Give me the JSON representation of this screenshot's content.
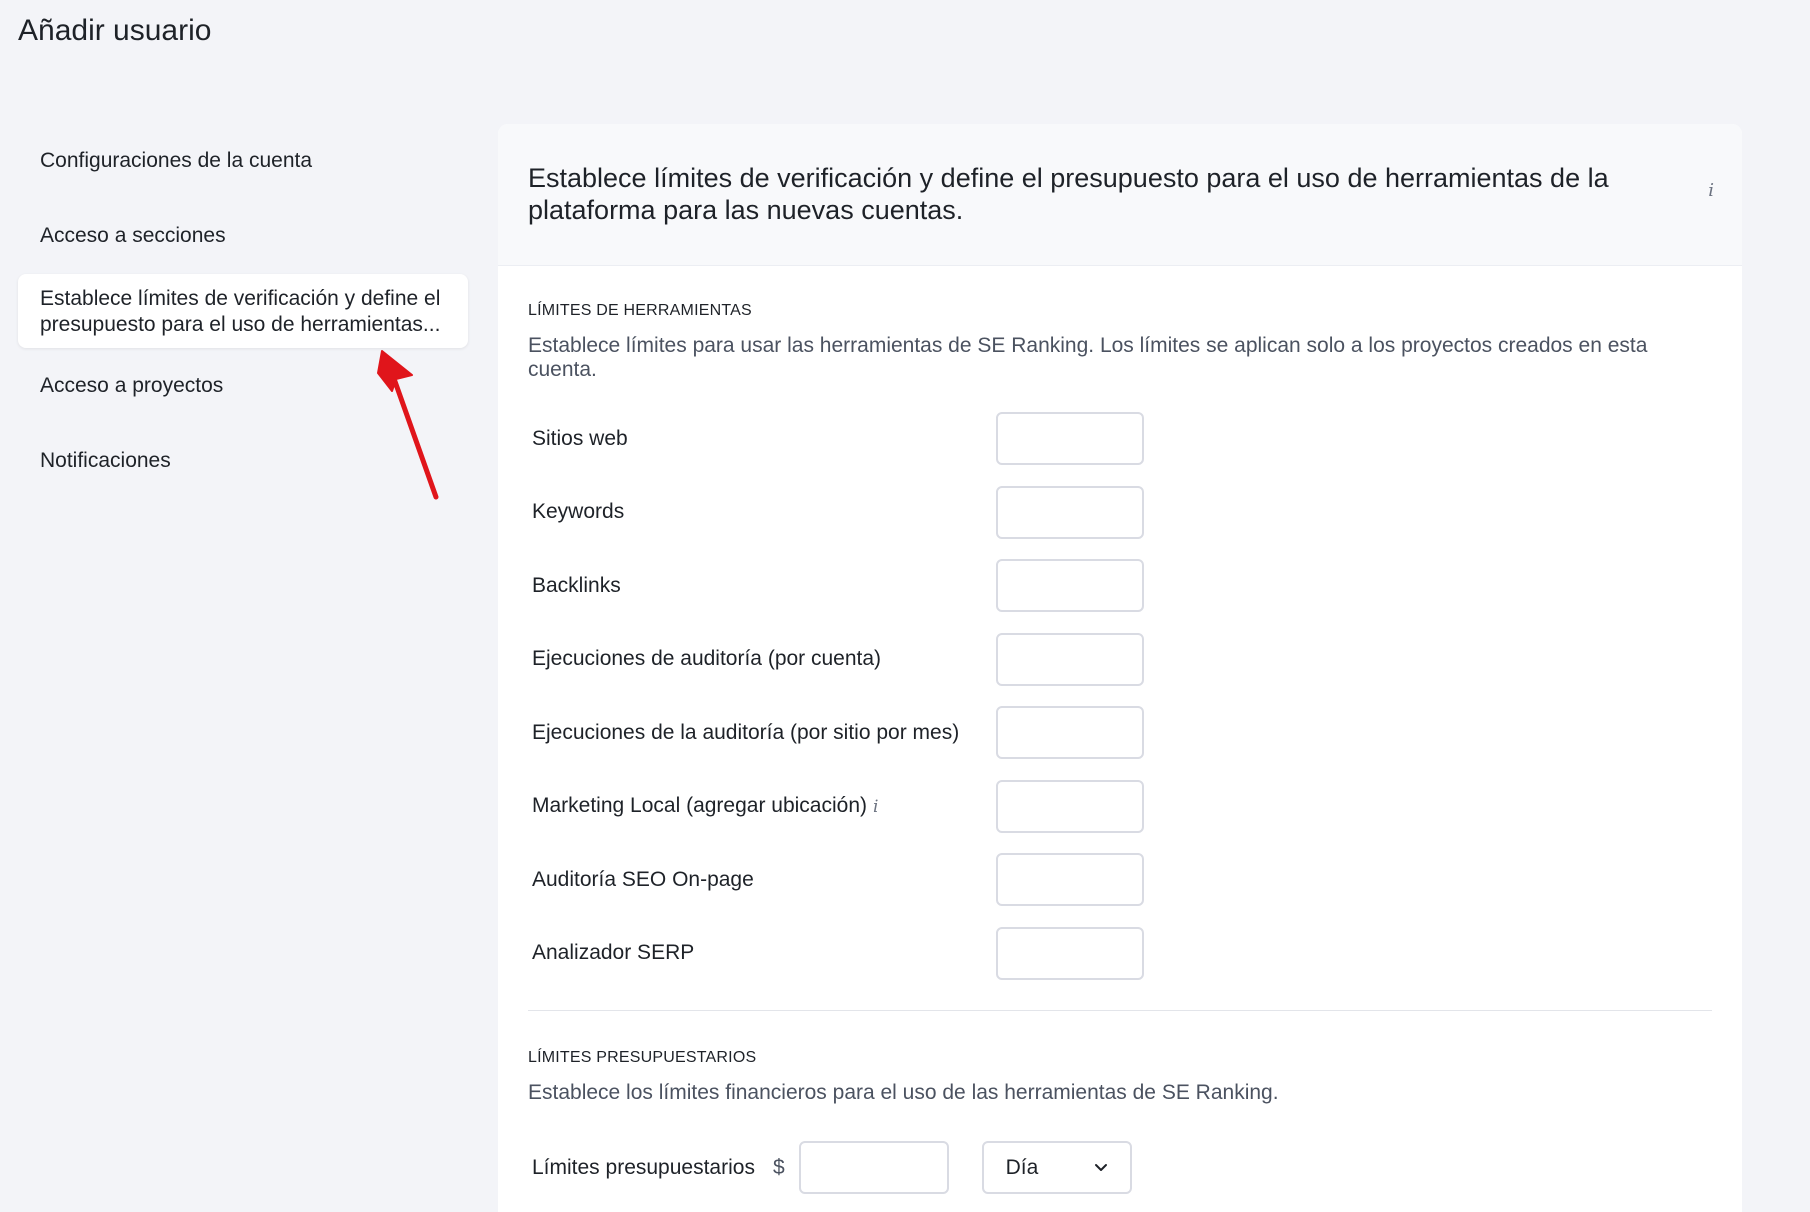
{
  "page": {
    "title": "Añadir usuario"
  },
  "sidebar": {
    "items": [
      {
        "label": "Configuraciones de la cuenta"
      },
      {
        "label": "Acceso a secciones"
      },
      {
        "label_line1": "Establece límites de verificación y define el",
        "label_line2": "presupuesto para el uso de herramientas..."
      },
      {
        "label": "Acceso a proyectos"
      },
      {
        "label": "Notificaciones"
      }
    ]
  },
  "panel": {
    "heading": "Establece límites de verificación y define el presupuesto para el uso de herramientas de la plataforma para las nuevas cuentas.",
    "info_icon": "i"
  },
  "tool_limits": {
    "title": "LÍMITES DE HERRAMIENTAS",
    "description": "Establece límites para usar las herramientas de SE Ranking. Los límites se aplican solo a los proyectos creados en esta cuenta.",
    "rows": [
      {
        "label": "Sitios web",
        "value": ""
      },
      {
        "label": "Keywords",
        "value": ""
      },
      {
        "label": "Backlinks",
        "value": ""
      },
      {
        "label": "Ejecuciones de auditoría (por cuenta)",
        "value": ""
      },
      {
        "label": "Ejecuciones de la auditoría (por sitio por mes)",
        "value": ""
      },
      {
        "label": "Marketing Local (agregar ubicación)",
        "value": "",
        "info": "i"
      },
      {
        "label": "Auditoría SEO On-page",
        "value": ""
      },
      {
        "label": "Analizador SERP",
        "value": ""
      }
    ]
  },
  "budget_limits": {
    "title": "LÍMITES PRESUPUESTARIOS",
    "description": "Establece los límites financieros para el uso de las herramientas de SE Ranking.",
    "label": "Límites presupuestarios",
    "currency": "$",
    "value": "",
    "period": "Día"
  },
  "colors": {
    "arrow": "#e0151b",
    "background": "#f3f4f8"
  }
}
